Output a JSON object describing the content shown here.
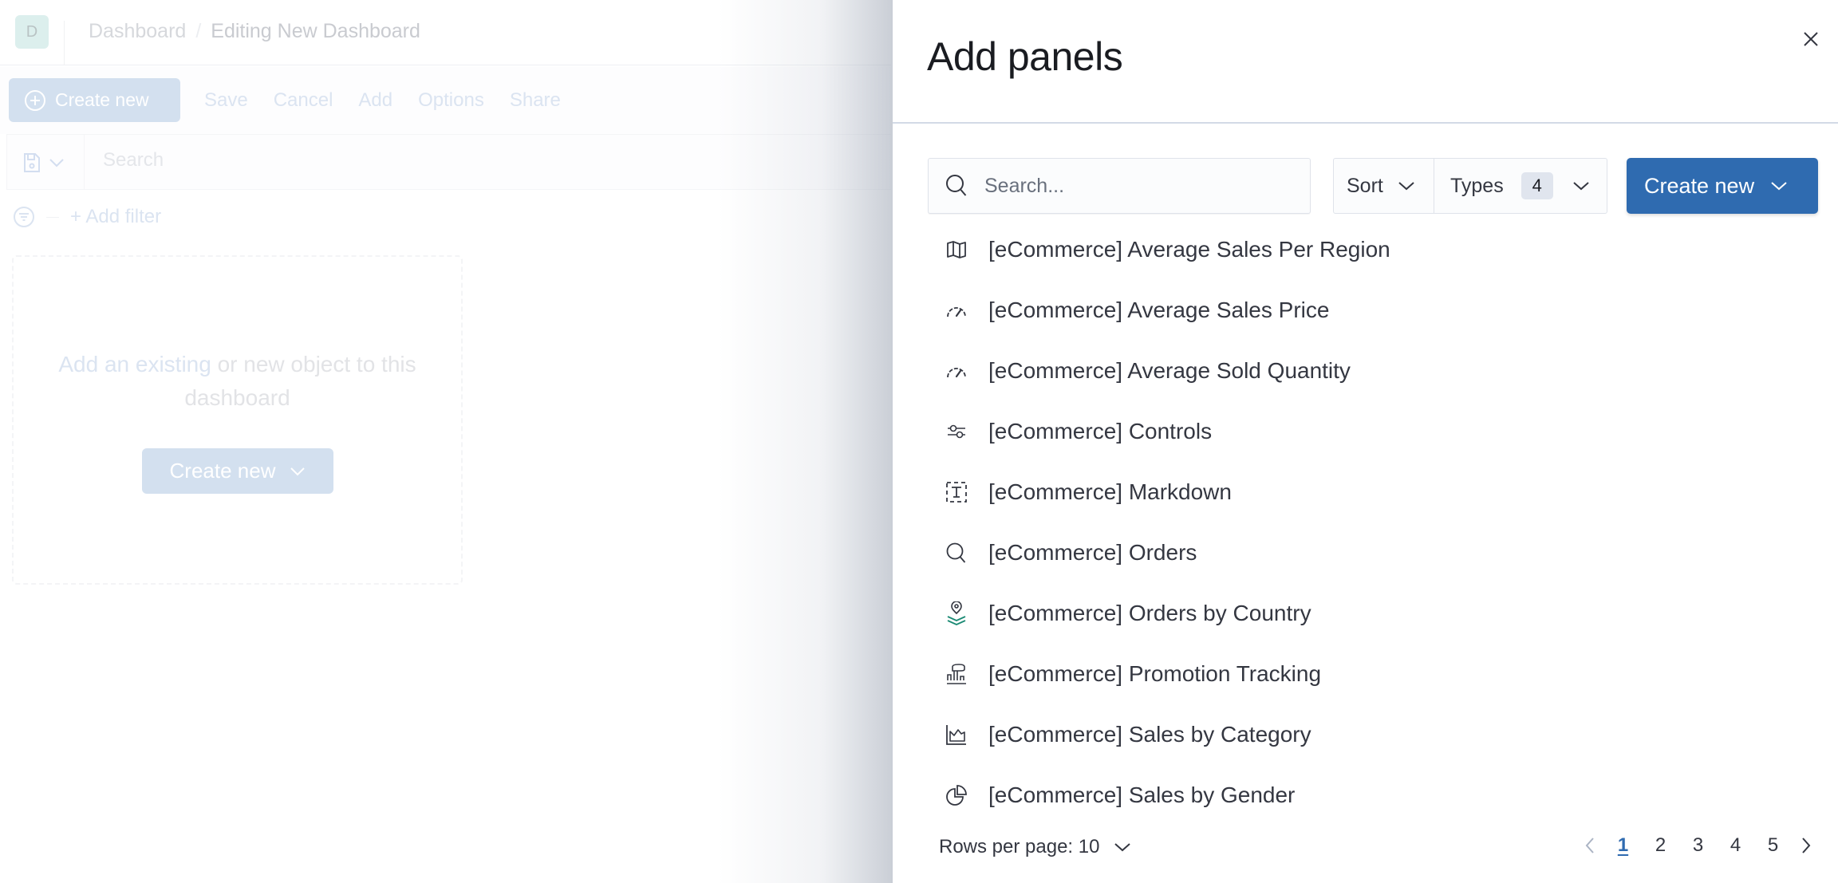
{
  "background_app": {
    "avatar_letter": "D",
    "breadcrumbs": [
      "Dashboard",
      "Editing New Dashboard"
    ],
    "breadcrumb_separator": "/",
    "toolbar": {
      "create_new_label": "Create new",
      "links": [
        "Save",
        "Cancel",
        "Add",
        "Options",
        "Share"
      ]
    },
    "query_bar": {
      "placeholder": "Search"
    },
    "filter_bar": {
      "add_filter_label": "+ Add filter"
    },
    "empty_panel": {
      "link_text": "Add an existing",
      "rest_text": " or new object to this dashboard",
      "create_new_label": "Create new"
    }
  },
  "flyout": {
    "title": "Add panels",
    "search": {
      "placeholder": "Search...",
      "value": ""
    },
    "sort_label": "Sort",
    "types_label": "Types",
    "types_count": "4",
    "create_new_label": "Create new",
    "items": [
      {
        "label": "[eCommerce] Average Sales Per Region",
        "icon": "map-icon"
      },
      {
        "label": "[eCommerce] Average Sales Price",
        "icon": "gauge-icon"
      },
      {
        "label": "[eCommerce] Average Sold Quantity",
        "icon": "gauge-icon"
      },
      {
        "label": "[eCommerce] Controls",
        "icon": "controls-icon"
      },
      {
        "label": "[eCommerce] Markdown",
        "icon": "markdown-icon"
      },
      {
        "label": "[eCommerce] Orders",
        "icon": "search-icon"
      },
      {
        "label": "[eCommerce] Orders by Country",
        "icon": "maps-app-icon"
      },
      {
        "label": "[eCommerce] Promotion Tracking",
        "icon": "tsvb-icon"
      },
      {
        "label": "[eCommerce] Sales by Category",
        "icon": "area-chart-icon"
      },
      {
        "label": "[eCommerce] Sales by Gender",
        "icon": "pie-chart-icon"
      }
    ],
    "rows_per_page_label": "Rows per page: 10",
    "pagination": {
      "pages": [
        "1",
        "2",
        "3",
        "4",
        "5"
      ],
      "current": "1"
    }
  },
  "colors": {
    "primary": "#2f6bb0",
    "text": "#343741",
    "title": "#1a1c21",
    "maps_accent": "#1b8a74"
  }
}
